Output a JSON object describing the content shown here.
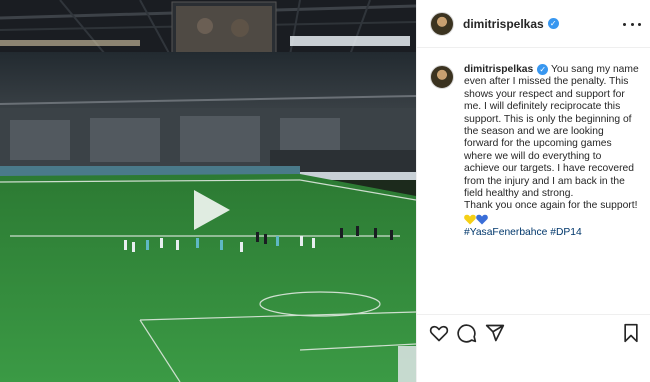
{
  "post": {
    "username": "dimitrispelkas",
    "caption_lines": [
      "You sang my name",
      "even after I missed the penalty. This",
      "shows your respect and support for",
      "me. I will definitely reciprocate this",
      "support. This is only the beginning of",
      "the season and we are looking",
      "forward for the upcoming games",
      "where we will do everything to",
      "achieve our targets. I have recovered",
      "from the injury and I am back in the",
      "field healthy and strong.",
      "Thank you once again for the support!"
    ],
    "hashtags": "#YasaFenerbahce #DP14"
  },
  "colors": {
    "verified_badge": "#3897f0",
    "hashtag": "#00376b",
    "heart_yellow": "#f5d016",
    "heart_blue": "#3a6ed8",
    "pitch": "#2f8a3a"
  },
  "icons": {
    "header_more": "more-icon",
    "verified": "verified-badge-icon",
    "play": "play-icon",
    "like": "heart-outline-icon",
    "comment": "comment-icon",
    "share": "share-icon",
    "save": "bookmark-icon"
  }
}
